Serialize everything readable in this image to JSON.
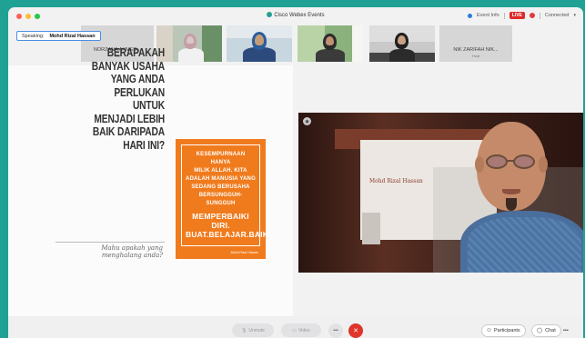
{
  "window": {
    "title": "Cisco Webex Events",
    "colors": {
      "frame": "#1fa293",
      "window_bg": "#f2f2f3"
    }
  },
  "titlebar": {
    "traffic_lights": [
      "#ff5f57",
      "#febc2e",
      "#28c840"
    ],
    "event_info": "Event Info",
    "live_badge": "LIVE",
    "connected": "Connected"
  },
  "speaking": {
    "label": "Speaking:",
    "name": "Mohd Rizal Hassan"
  },
  "participants": [
    {
      "name": "NORZANA AHMED...",
      "sub": "Me",
      "kind": "name_only"
    },
    {
      "name": "",
      "kind": "video"
    },
    {
      "name": "",
      "kind": "video"
    },
    {
      "name": "",
      "kind": "video"
    },
    {
      "name": "",
      "kind": "video"
    },
    {
      "name": "NIK ZARIFAH NIK...",
      "sub": "Host",
      "kind": "name_only"
    }
  ],
  "slide": {
    "question_lines": [
      "BERAPAKAH",
      "BANYAK USAHA",
      "YANG ANDA",
      "PERLUKAN UNTUK",
      "MENJADI LEBIH",
      "BAIK DARIPADA",
      "HARI INI?"
    ],
    "subtitle_lines": [
      "Mahu apakah yang",
      "menghalang anda?"
    ],
    "quote_lines": [
      "KESEMPURNAAN HANYA",
      "MILIK ALLAH. KITA",
      "ADALAH MANUSIA YANG",
      "SEDANG BERUSAHA",
      "BERSUNGGUH-SUNGGUH"
    ],
    "quote_big": [
      "MEMPERBAIKI DIRI.",
      "BUAT.BELAJAR.BAIKI."
    ],
    "quote_author": "Mohd Rizal Hassan",
    "colors": {
      "accent": "#f07b1d"
    }
  },
  "video": {
    "background_board_text": "Mohd Rizal Hassan"
  },
  "bottombar": {
    "mute_label": "Unmute",
    "video_label": "Video",
    "more_icon": "•••",
    "leave_icon": "✕",
    "participants_label": "Participants",
    "chat_label": "Chat",
    "more_right": "•••"
  }
}
